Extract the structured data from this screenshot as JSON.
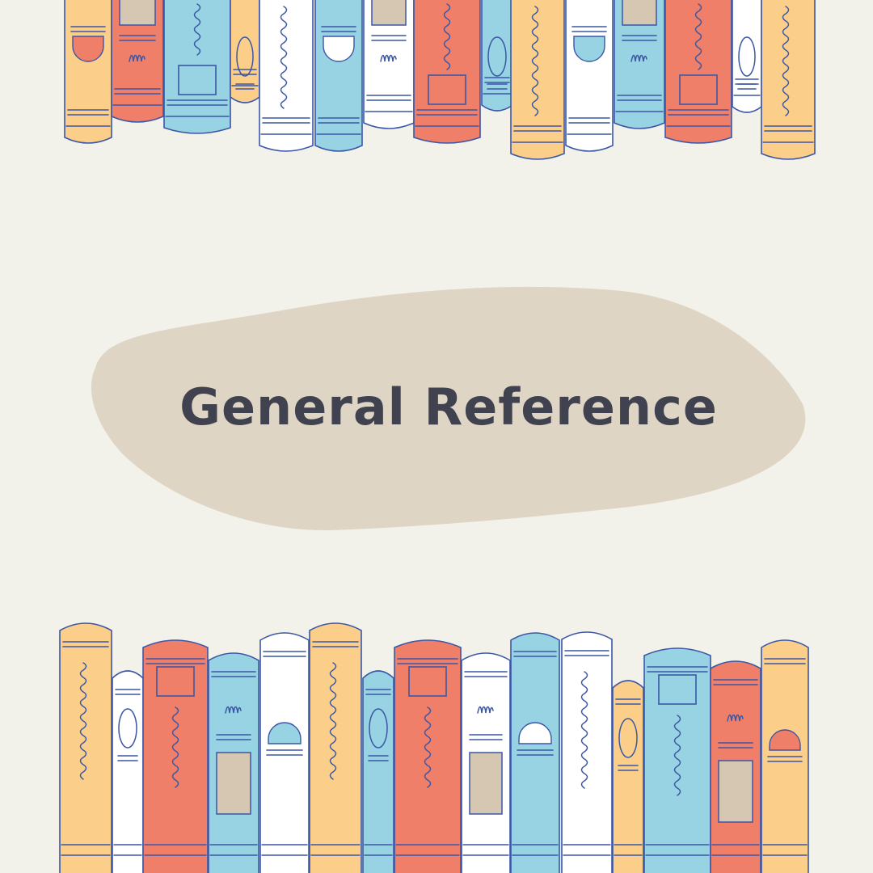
{
  "title": "General Reference",
  "colors": {
    "background": "#f3f2ea",
    "blob": "#dfd5c5",
    "title_text": "#40424f",
    "outline": "#3b57a6",
    "orange": "#fbcf89",
    "red": "#ef7f68",
    "blue": "#97d3e2",
    "white": "#ffffff",
    "tan": "#d6c7b2"
  },
  "top_books": [
    {
      "color": "orange",
      "motif": "semi-red"
    },
    {
      "color": "red",
      "motif": "tan-label-scribble"
    },
    {
      "color": "blue",
      "motif": "wave-rect"
    },
    {
      "color": "orange",
      "motif": "oval"
    },
    {
      "color": "white",
      "motif": "vertical-wave"
    },
    {
      "color": "blue",
      "motif": "semi-white"
    },
    {
      "color": "white",
      "motif": "tan-label-scribble"
    },
    {
      "color": "red",
      "motif": "wave-rect"
    },
    {
      "color": "blue",
      "motif": "oval"
    },
    {
      "color": "orange",
      "motif": "vertical-wave"
    },
    {
      "color": "white",
      "motif": "semi-blue"
    },
    {
      "color": "blue",
      "motif": "tan-label-scribble"
    },
    {
      "color": "red",
      "motif": "wave-rect"
    },
    {
      "color": "white",
      "motif": "oval"
    },
    {
      "color": "orange",
      "motif": "vertical-wave"
    }
  ],
  "bottom_books": [
    {
      "color": "orange",
      "motif": "vertical-wave"
    },
    {
      "color": "white",
      "motif": "oval"
    },
    {
      "color": "red",
      "motif": "rect-wave"
    },
    {
      "color": "blue",
      "motif": "scribble-tan"
    },
    {
      "color": "white",
      "motif": "semi-blue"
    },
    {
      "color": "orange",
      "motif": "vertical-wave"
    },
    {
      "color": "blue",
      "motif": "oval"
    },
    {
      "color": "red",
      "motif": "rect-wave"
    },
    {
      "color": "white",
      "motif": "scribble-tan"
    },
    {
      "color": "blue",
      "motif": "semi-white"
    },
    {
      "color": "white",
      "motif": "vertical-wave"
    },
    {
      "color": "orange",
      "motif": "oval"
    },
    {
      "color": "blue",
      "motif": "rect-wave"
    },
    {
      "color": "red",
      "motif": "scribble-tan"
    },
    {
      "color": "orange",
      "motif": "semi-red"
    }
  ]
}
